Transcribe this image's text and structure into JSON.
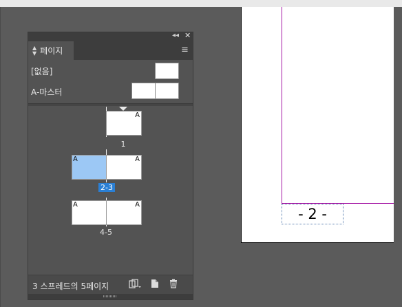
{
  "panel": {
    "tab_label": "페이지",
    "collapse_glyph": "◂◂",
    "close_glyph": "✕",
    "menu_glyph": "≡"
  },
  "masters": [
    {
      "label": "[없음]"
    },
    {
      "label": "A-마스터"
    }
  ],
  "spreads": [
    {
      "label": "1",
      "pages": [
        {
          "master": "A",
          "selected": false
        }
      ]
    },
    {
      "label": "2-3",
      "pages": [
        {
          "master": "A",
          "selected": true
        },
        {
          "master": "A",
          "selected": false
        }
      ],
      "selected": true
    },
    {
      "label": "4-5",
      "pages": [
        {
          "master": "A",
          "selected": false
        },
        {
          "master": "A",
          "selected": false
        }
      ]
    }
  ],
  "footer": {
    "status": "3 스프레드의 5페이지"
  },
  "document": {
    "folio": "- 2 -"
  },
  "icons": [
    "collapse-icon",
    "close-icon",
    "panel-menu-icon",
    "edit-page-size-icon",
    "new-page-icon",
    "trash-icon"
  ],
  "colors": {
    "margin_guide": "#a313a3",
    "selection": "#2a7fd4",
    "selected_page": "#9cc8f5"
  }
}
